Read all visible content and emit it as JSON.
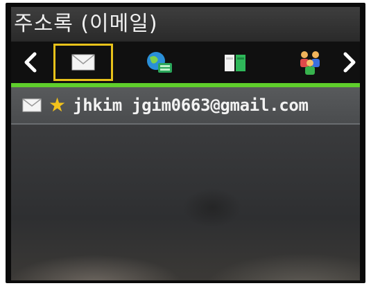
{
  "header": {
    "title": "주소록 (이메일)"
  },
  "tabs": {
    "prev_icon": "chevron-left-icon",
    "next_icon": "chevron-right-icon",
    "items": [
      {
        "icon": "email-icon",
        "selected": true
      },
      {
        "icon": "fax-globe-icon",
        "selected": false
      },
      {
        "icon": "shared-folder-icon",
        "selected": false
      },
      {
        "icon": "group-icon",
        "selected": false
      }
    ]
  },
  "list": {
    "items": [
      {
        "type_icon": "email-icon",
        "favorite": true,
        "text": "jhkim jgim0663@gmail.com"
      }
    ]
  },
  "colors": {
    "accent": "#5fcf2c",
    "selection": "#e8c21a",
    "star": "#f2c21b"
  }
}
